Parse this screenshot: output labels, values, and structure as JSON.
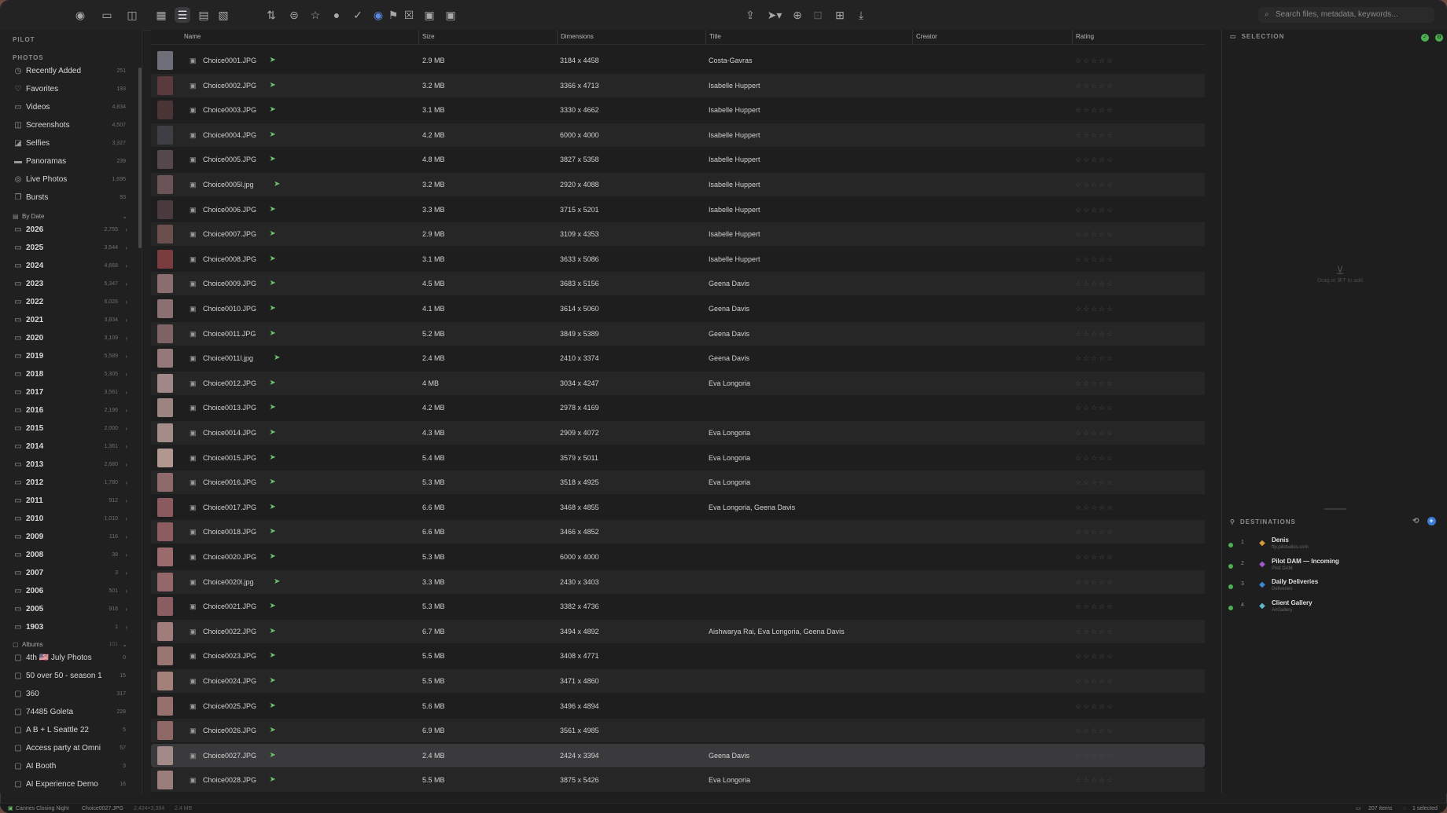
{
  "search": {
    "placeholder": "Search files, metadata, keywords..."
  },
  "sidebar": {
    "header_pilot": "PILOT",
    "header_photos": "PHOTOS",
    "smart": [
      {
        "label": "Recently Added",
        "count": "251",
        "icon": "clock"
      },
      {
        "label": "Favorites",
        "count": "193",
        "icon": "heart"
      },
      {
        "label": "Videos",
        "count": "4,834",
        "icon": "video"
      },
      {
        "label": "Screenshots",
        "count": "4,507",
        "icon": "screenshot"
      },
      {
        "label": "Selfies",
        "count": "3,327",
        "icon": "person"
      },
      {
        "label": "Panoramas",
        "count": "239",
        "icon": "panorama"
      },
      {
        "label": "Live Photos",
        "count": "1,695",
        "icon": "live"
      },
      {
        "label": "Bursts",
        "count": "93",
        "icon": "burst"
      }
    ],
    "by_date_label": "By Date",
    "years": [
      {
        "label": "2026",
        "count": "2,755"
      },
      {
        "label": "2025",
        "count": "3,544"
      },
      {
        "label": "2024",
        "count": "4,668"
      },
      {
        "label": "2023",
        "count": "5,347"
      },
      {
        "label": "2022",
        "count": "6,026"
      },
      {
        "label": "2021",
        "count": "3,834"
      },
      {
        "label": "2020",
        "count": "3,109"
      },
      {
        "label": "2019",
        "count": "5,589"
      },
      {
        "label": "2018",
        "count": "5,305"
      },
      {
        "label": "2017",
        "count": "3,561"
      },
      {
        "label": "2016",
        "count": "2,196"
      },
      {
        "label": "2015",
        "count": "2,000"
      },
      {
        "label": "2014",
        "count": "1,361"
      },
      {
        "label": "2013",
        "count": "2,680"
      },
      {
        "label": "2012",
        "count": "1,780"
      },
      {
        "label": "2011",
        "count": "912"
      },
      {
        "label": "2010",
        "count": "1,010"
      },
      {
        "label": "2009",
        "count": "116"
      },
      {
        "label": "2008",
        "count": "38"
      },
      {
        "label": "2007",
        "count": "3"
      },
      {
        "label": "2006",
        "count": "501"
      },
      {
        "label": "2005",
        "count": "918"
      },
      {
        "label": "1903",
        "count": "1"
      }
    ],
    "albums_label": "Albums",
    "albums": [
      {
        "label": "4th 🇺🇸 July Photos",
        "count": "0"
      },
      {
        "label": "50 over 50 - season 1",
        "count": "15"
      },
      {
        "label": "360",
        "count": "317"
      },
      {
        "label": "74485 Goleta",
        "count": "228"
      },
      {
        "label": "A B + L Seattle 22",
        "count": "5"
      },
      {
        "label": "Access party at Omni",
        "count": "57"
      },
      {
        "label": "AI Booth",
        "count": "3"
      },
      {
        "label": "AI Experience Demo",
        "count": "16"
      }
    ]
  },
  "columns": {
    "name": "Name",
    "size": "Size",
    "dimensions": "Dimensions",
    "title": "Title",
    "creator": "Creator",
    "rating": "Rating"
  },
  "rows": [
    {
      "name": "Choice0001.JPG",
      "size": "2.9 MB",
      "dims": "3184 x 4458",
      "title": "Costa-Gavras",
      "thumb": "#6e6e78"
    },
    {
      "name": "Choice0002.JPG",
      "size": "3.2 MB",
      "dims": "3366 x 4713",
      "title": "Isabelle Huppert",
      "thumb": "#5a3a3c"
    },
    {
      "name": "Choice0003.JPG",
      "size": "3.1 MB",
      "dims": "3330 x 4662",
      "title": "Isabelle Huppert",
      "thumb": "#4a3436"
    },
    {
      "name": "Choice0004.JPG",
      "size": "4.2 MB",
      "dims": "6000 x 4000",
      "title": "Isabelle Huppert",
      "thumb": "#3e3e44"
    },
    {
      "name": "Choice0005.JPG",
      "size": "4.8 MB",
      "dims": "3827 x 5358",
      "title": "Isabelle Huppert",
      "thumb": "#55484c"
    },
    {
      "name": "Choice0005l.jpg",
      "size": "3.2 MB",
      "dims": "2920 x 4088",
      "title": "Isabelle Huppert",
      "thumb": "#6a5458"
    },
    {
      "name": "Choice0006.JPG",
      "size": "3.3 MB",
      "dims": "3715 x 5201",
      "title": "Isabelle Huppert",
      "thumb": "#4b3b3e"
    },
    {
      "name": "Choice0007.JPG",
      "size": "2.9 MB",
      "dims": "3109 x 4353",
      "title": "Isabelle Huppert",
      "thumb": "#6b4f4f"
    },
    {
      "name": "Choice0008.JPG",
      "size": "3.1 MB",
      "dims": "3633 x 5086",
      "title": "Isabelle Huppert",
      "thumb": "#7a3c3e"
    },
    {
      "name": "Choice0009.JPG",
      "size": "4.5 MB",
      "dims": "3683 x 5156",
      "title": "Geena Davis",
      "thumb": "#8a6e70"
    },
    {
      "name": "Choice0010.JPG",
      "size": "4.1 MB",
      "dims": "3614 x 5060",
      "title": "Geena Davis",
      "thumb": "#8a7072"
    },
    {
      "name": "Choice0011.JPG",
      "size": "5.2 MB",
      "dims": "3849 x 5389",
      "title": "Geena Davis",
      "thumb": "#7e6466"
    },
    {
      "name": "Choice0011l.jpg",
      "size": "2.4 MB",
      "dims": "2410 x 3374",
      "title": "Geena Davis",
      "thumb": "#94787a"
    },
    {
      "name": "Choice0012.JPG",
      "size": "4 MB",
      "dims": "3034 x 4247",
      "title": "Eva Longoria",
      "thumb": "#a08888"
    },
    {
      "name": "Choice0013.JPG",
      "size": "4.2 MB",
      "dims": "2978 x 4169",
      "title": "",
      "thumb": "#9c8482"
    },
    {
      "name": "Choice0014.JPG",
      "size": "4.3 MB",
      "dims": "2909 x 4072",
      "title": "Eva Longoria",
      "thumb": "#a48c88"
    },
    {
      "name": "Choice0015.JPG",
      "size": "5.4 MB",
      "dims": "3579 x 5011",
      "title": "Eva Longoria",
      "thumb": "#b09890"
    },
    {
      "name": "Choice0016.JPG",
      "size": "5.3 MB",
      "dims": "3518 x 4925",
      "title": "Eva Longoria",
      "thumb": "#8e6a6c"
    },
    {
      "name": "Choice0017.JPG",
      "size": "6.6 MB",
      "dims": "3468 x 4855",
      "title": "Eva Longoria, Geena Davis",
      "thumb": "#8a5a5e"
    },
    {
      "name": "Choice0018.JPG",
      "size": "6.6 MB",
      "dims": "3466 x 4852",
      "title": "",
      "thumb": "#8c5c60"
    },
    {
      "name": "Choice0020.JPG",
      "size": "5.3 MB",
      "dims": "6000 x 4000",
      "title": "",
      "thumb": "#9a6a6c"
    },
    {
      "name": "Choice0020l.jpg",
      "size": "3.3 MB",
      "dims": "2430 x 3403",
      "title": "",
      "thumb": "#94686a"
    },
    {
      "name": "Choice0021.JPG",
      "size": "5.3 MB",
      "dims": "3382 x 4736",
      "title": "",
      "thumb": "#8a5e62"
    },
    {
      "name": "Choice0022.JPG",
      "size": "6.7 MB",
      "dims": "3494 x 4892",
      "title": "Aishwarya Rai, Eva Longoria, Geena Davis",
      "thumb": "#a07c7a"
    },
    {
      "name": "Choice0023.JPG",
      "size": "5.5 MB",
      "dims": "3408 x 4771",
      "title": "",
      "thumb": "#9a7672"
    },
    {
      "name": "Choice0024.JPG",
      "size": "5.5 MB",
      "dims": "3471 x 4860",
      "title": "",
      "thumb": "#a4807a"
    },
    {
      "name": "Choice0025.JPG",
      "size": "5.6 MB",
      "dims": "3496 x 4894",
      "title": "",
      "thumb": "#96706c"
    },
    {
      "name": "Choice0026.JPG",
      "size": "6.9 MB",
      "dims": "3561 x 4985",
      "title": "",
      "thumb": "#8e6866"
    },
    {
      "name": "Choice0027.JPG",
      "size": "2.4 MB",
      "dims": "2424 x 3394",
      "title": "Geena Davis",
      "thumb": "#a28a88"
    },
    {
      "name": "Choice0028.JPG",
      "size": "5.5 MB",
      "dims": "3875 x 5426",
      "title": "Eva Longoria",
      "thumb": "#9a7e7c"
    }
  ],
  "selection": {
    "header": "SELECTION",
    "drop_hint": "Drag or ⌘T to add"
  },
  "destinations": {
    "header": "DESTINATIONS",
    "items": [
      {
        "num": "1",
        "name": "Denis",
        "sub": "ftp.pilotudios.com",
        "icon_color": "#d89a3c"
      },
      {
        "num": "2",
        "name": "Pilot DAM — Incoming",
        "sub": "Pilot DAM",
        "icon_color": "#a05ad0"
      },
      {
        "num": "3",
        "name": "Daily Deliveries",
        "sub": "Deliveries",
        "icon_color": "#3a8ad8"
      },
      {
        "num": "4",
        "name": "Client Gallery",
        "sub": "AirGallery",
        "icon_color": "#5ab8c8"
      }
    ]
  },
  "statusbar": {
    "album": "Cannes Closing Night",
    "file": "Choice0027.JPG",
    "dims": "2,424×3,394",
    "size": "2.4 MB",
    "items": "207 items",
    "selected": "1 selected"
  }
}
